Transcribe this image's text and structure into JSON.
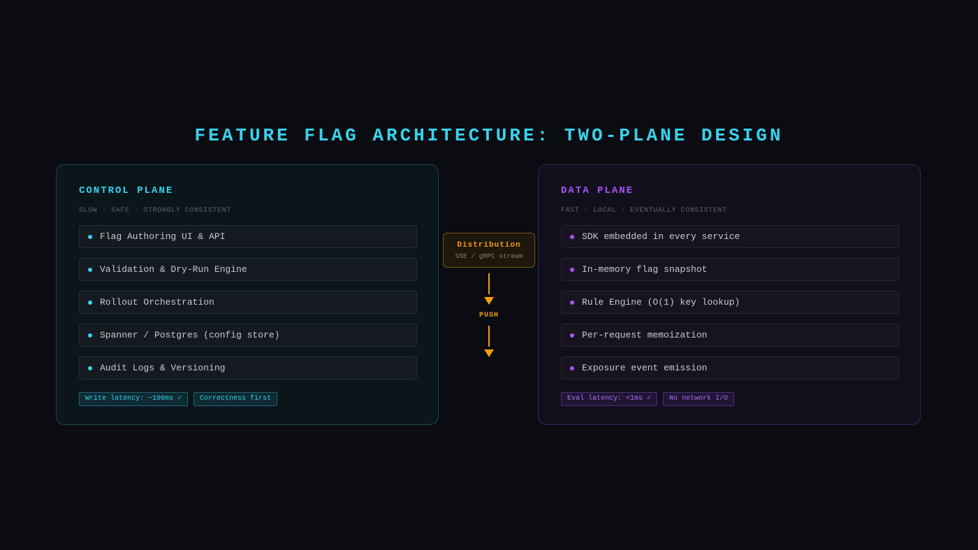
{
  "title": "FEATURE FLAG ARCHITECTURE: TWO-PLANE DESIGN",
  "control_plane": {
    "title": "CONTROL PLANE",
    "subtitle": "SLOW · SAFE · STRONGLY CONSISTENT",
    "items": [
      "Flag Authoring UI & API",
      "Validation & Dry-Run Engine",
      "Rollout Orchestration",
      "Spanner / Postgres (config store)",
      "Audit Logs & Versioning"
    ],
    "tags": [
      "Write latency: ~100ms ✓",
      "Correctness first"
    ]
  },
  "data_plane": {
    "title": "DATA PLANE",
    "subtitle": "FAST · LOCAL · EVENTUALLY CONSISTENT",
    "items": [
      "SDK embedded in every service",
      "In-memory flag snapshot",
      "Rule Engine (O(1) key lookup)",
      "Per-request memoization",
      "Exposure event emission"
    ],
    "tags": [
      "Eval latency: <1ms ✓",
      "No network I/O"
    ]
  },
  "distribution": {
    "title": "Distribution",
    "subtitle": "SSE / gRPC stream",
    "push_label": "PUSH"
  },
  "colors": {
    "background": "#0a0c11",
    "control_accent": "#38d3ee",
    "data_accent": "#a855f7",
    "distribution_accent": "#f59e0b"
  }
}
